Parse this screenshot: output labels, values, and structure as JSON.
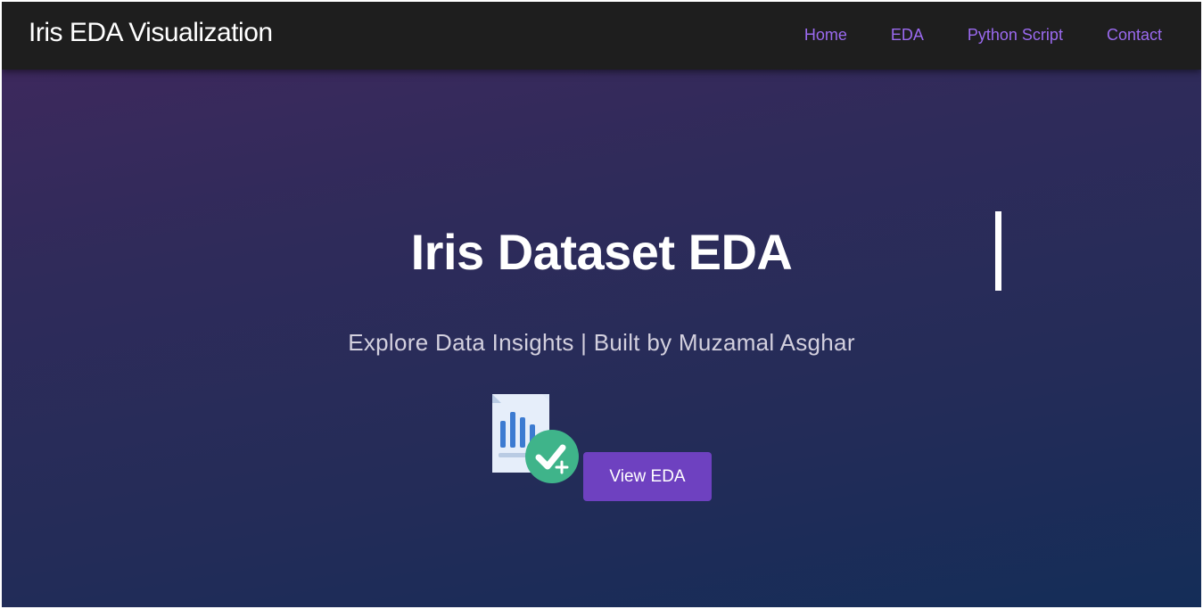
{
  "navbar": {
    "brand": "Iris EDA Visualization",
    "links": [
      {
        "label": "Home"
      },
      {
        "label": "EDA"
      },
      {
        "label": "Python Script"
      },
      {
        "label": "Contact"
      }
    ]
  },
  "hero": {
    "title": "Iris Dataset EDA",
    "subtitle": "Explore Data Insights | Built by Muzamal Asghar",
    "icon": "report-chart-check-icon",
    "button_label": "View EDA"
  },
  "colors": {
    "navbar_bg": "#1e1e1e",
    "link": "#9b6af0",
    "button": "#6e41c0",
    "gradient_top": "#41285e",
    "gradient_bottom": "#142d58",
    "check_badge": "#3fb48a"
  }
}
